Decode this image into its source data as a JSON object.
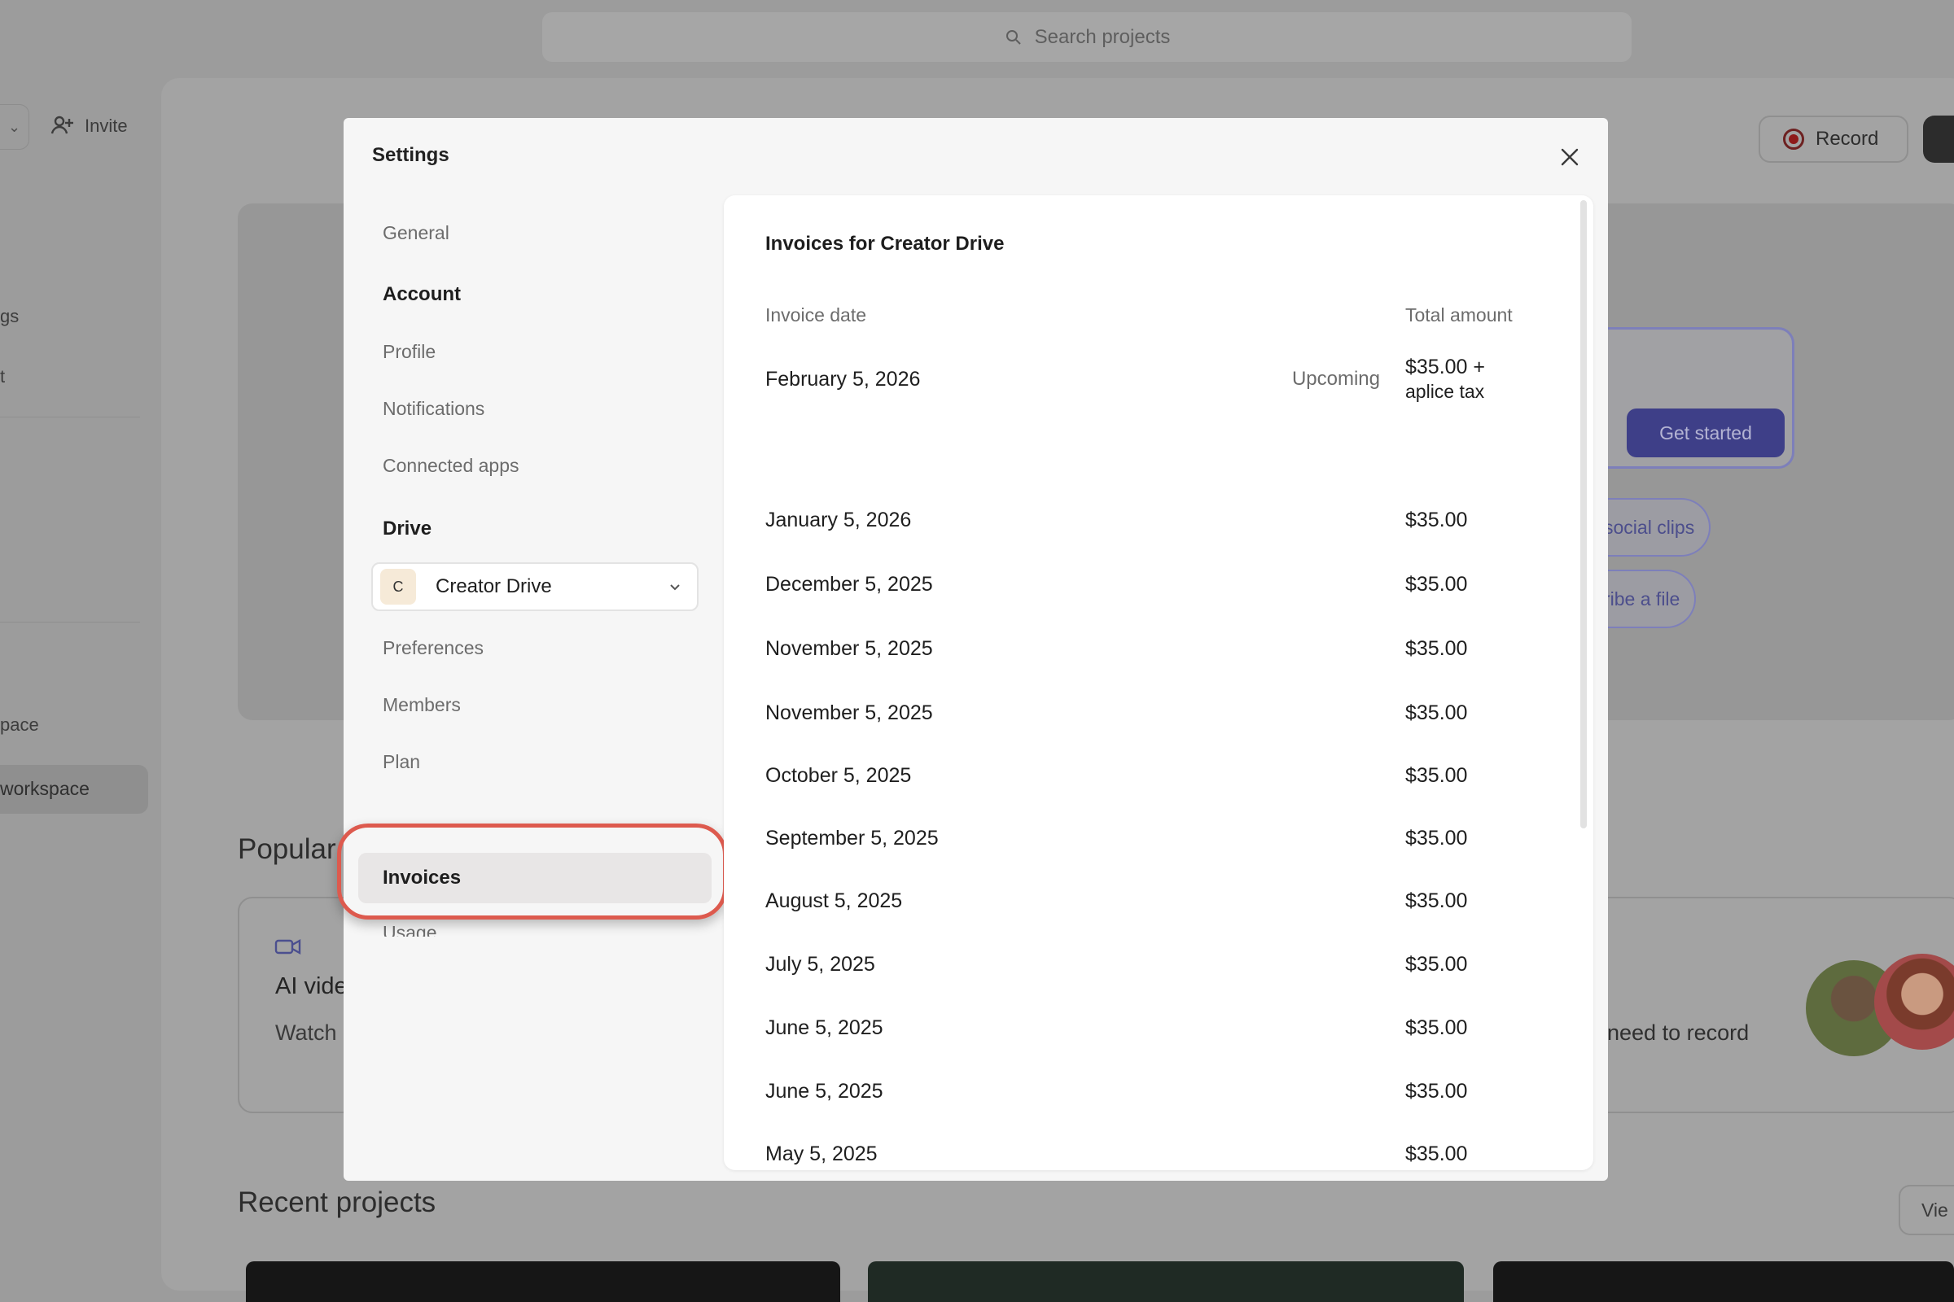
{
  "search": {
    "placeholder": "Search projects"
  },
  "background": {
    "invite_label": "Invite",
    "sidebar_fragments": [
      "gs",
      "t",
      "pace",
      "workspace"
    ],
    "record_label": "Record",
    "get_started_label": "Get started",
    "chips": [
      "social clips",
      "ribe a file"
    ],
    "popular_heading": "Popular",
    "feature_title": "AI vide",
    "feature_desc": "Watch",
    "feature_right_text": "need to record",
    "recent_heading": "Recent projects",
    "view_label": "Vie"
  },
  "modal": {
    "title": "Settings",
    "nav": {
      "general": "General",
      "account_section": "Account",
      "profile": "Profile",
      "notifications": "Notifications",
      "connected_apps": "Connected apps",
      "drive_section": "Drive",
      "drive_badge": "C",
      "drive_name": "Creator Drive",
      "preferences": "Preferences",
      "members": "Members",
      "plan": "Plan",
      "usage": "Usage",
      "invoices": "Invoices"
    },
    "invoices": {
      "title": "Invoices for Creator Drive",
      "col_date": "Invoice date",
      "col_amount": "Total amount",
      "rows": [
        {
          "date": "February 5, 2026",
          "status": "Upcoming",
          "amount": "$35.00 +",
          "amount_note": "aplice tax"
        },
        {
          "date": "January 5, 2026",
          "status": "",
          "amount": "$35.00"
        },
        {
          "date": "December 5, 2025",
          "status": "",
          "amount": "$35.00"
        },
        {
          "date": "November 5, 2025",
          "status": "",
          "amount": "$35.00"
        },
        {
          "date": "November 5, 2025",
          "status": "",
          "amount": "$35.00"
        },
        {
          "date": "October 5, 2025",
          "status": "",
          "amount": "$35.00"
        },
        {
          "date": "September 5, 2025",
          "status": "",
          "amount": "$35.00"
        },
        {
          "date": "August 5, 2025",
          "status": "",
          "amount": "$35.00"
        },
        {
          "date": "July 5, 2025",
          "status": "",
          "amount": "$35.00"
        },
        {
          "date": "June 5, 2025",
          "status": "",
          "amount": "$35.00"
        },
        {
          "date": "June 5, 2025",
          "status": "",
          "amount": "$35.00"
        },
        {
          "date": "May 5, 2025",
          "status": "",
          "amount": "$35.00"
        }
      ]
    }
  },
  "colors": {
    "highlight_ring": "#dd5a4e",
    "accent": "#3e3f88"
  }
}
